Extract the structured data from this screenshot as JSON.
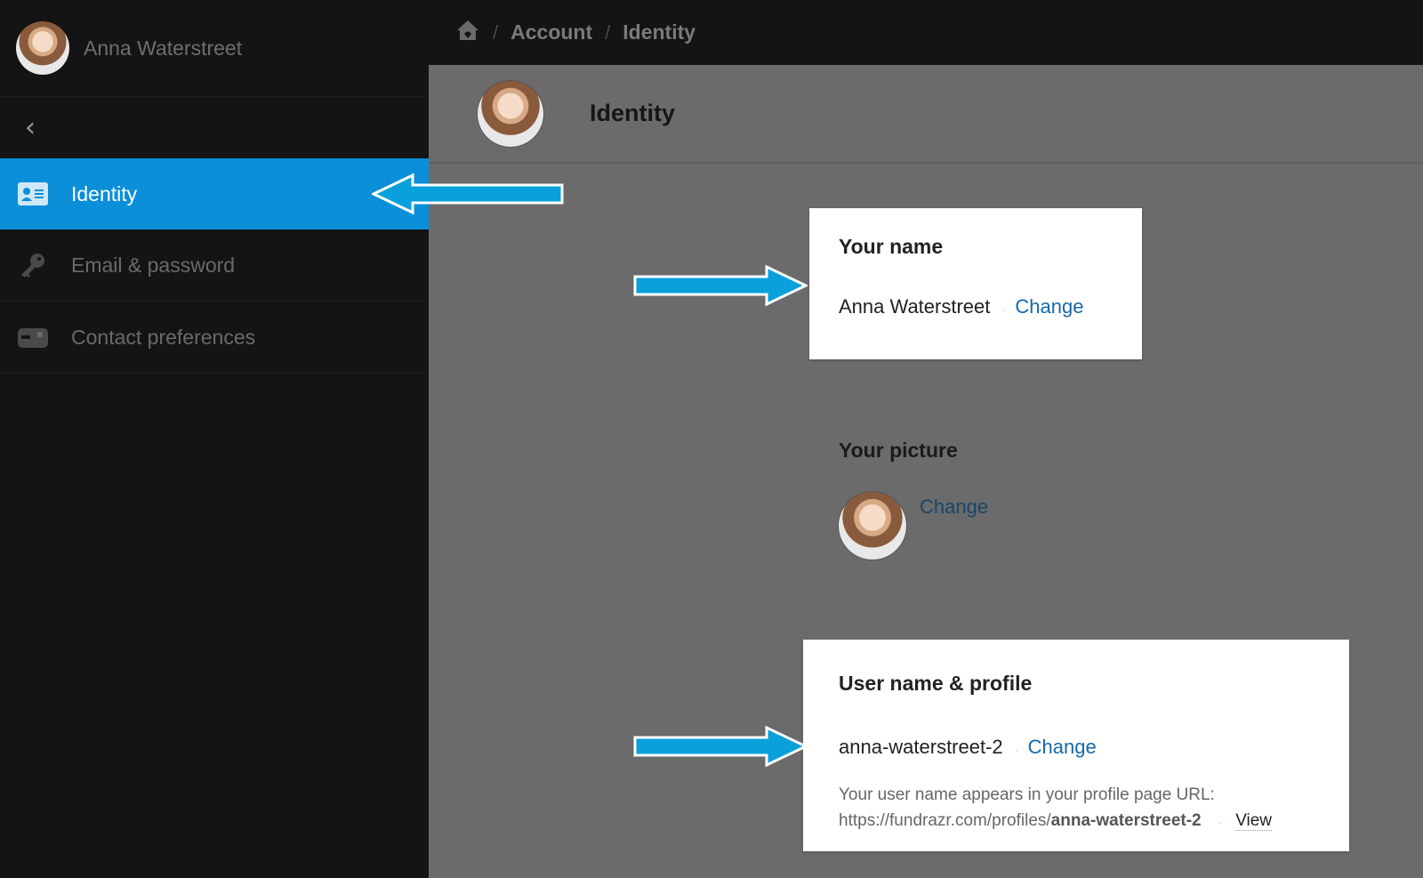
{
  "sidebar": {
    "user_name": "Anna Waterstreet",
    "items": [
      {
        "label": "Identity",
        "icon": "id-card-icon",
        "active": true
      },
      {
        "label": "Email & password",
        "icon": "key-icon",
        "active": false
      },
      {
        "label": "Contact preferences",
        "icon": "mailbox-icon",
        "active": false
      }
    ]
  },
  "breadcrumb": {
    "home_icon": "home-icon",
    "items": [
      "Account",
      "Identity"
    ]
  },
  "page": {
    "title": "Identity"
  },
  "name_section": {
    "title": "Your name",
    "value": "Anna Waterstreet",
    "change_label": "Change"
  },
  "picture_section": {
    "title": "Your picture",
    "change_label": "Change"
  },
  "username_section": {
    "title": "User name & profile",
    "value": "anna-waterstreet-2",
    "change_label": "Change",
    "note_line1": "Your user name appears in your profile page URL:",
    "url_prefix": "https://fundrazr.com/profiles/",
    "url_slug": "anna-waterstreet-2",
    "view_label": "View"
  },
  "colors": {
    "accent": "#0a8fd8",
    "arrow": "#0aa0dc",
    "link": "#1569a8"
  }
}
